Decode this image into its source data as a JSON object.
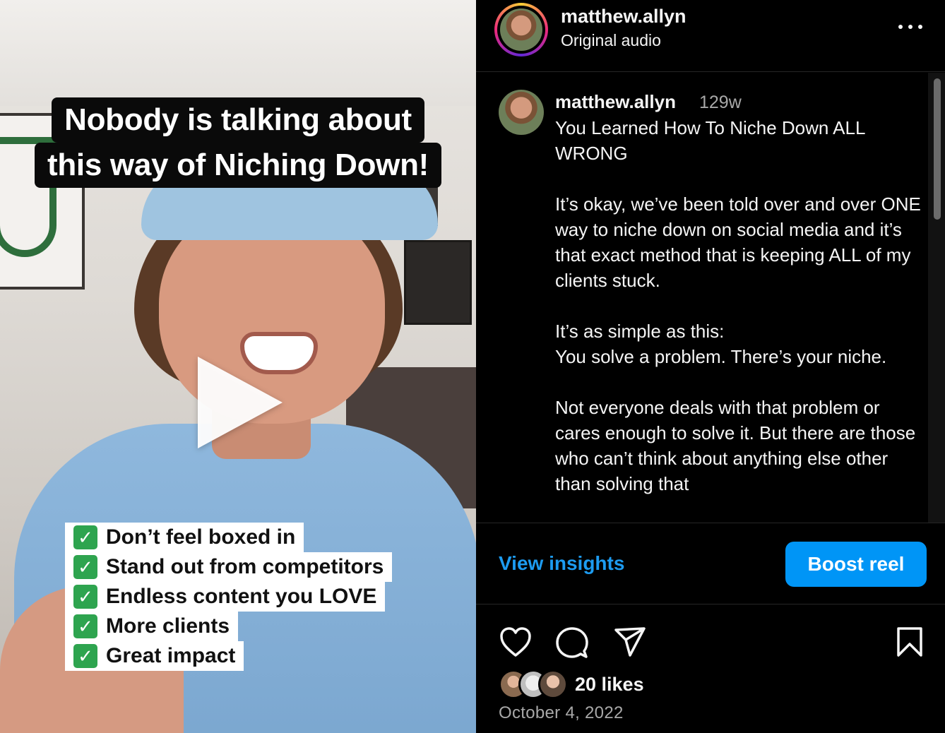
{
  "video": {
    "caption_line1": "Nobody is talking about",
    "caption_line2": "this way of Niching Down!",
    "checklist": [
      "Don’t feel boxed in",
      "Stand out from competitors",
      "Endless content you LOVE",
      "More clients",
      "Great impact"
    ],
    "play_icon": "play-icon",
    "check_icon": "white-check-mark-icon"
  },
  "header": {
    "username": "matthew.allyn",
    "audio": "Original audio",
    "more_icon": "more-horizontal-icon"
  },
  "comment": {
    "username": "matthew.allyn",
    "time": "129w",
    "text": "You Learned How To Niche Down ALL WRONG\n\nIt’s okay, we’ve been told over and over ONE way to niche down on social media and it’s that exact method that is keeping ALL of my clients stuck.\n\nIt’s as simple as this:\nYou solve a problem. There’s your niche.\n\nNot everyone deals with that problem or cares enough to solve it. But there are those who can’t think about anything else other than solving that"
  },
  "actions": {
    "view_insights": "View insights",
    "boost_reel": "Boost reel"
  },
  "engagement": {
    "likes": "20 likes",
    "date": "October 4, 2022"
  },
  "colors": {
    "accent_blue": "#0095f6",
    "link_blue": "#1d9bf0",
    "background": "#000000",
    "check_green": "#2ea44f"
  }
}
